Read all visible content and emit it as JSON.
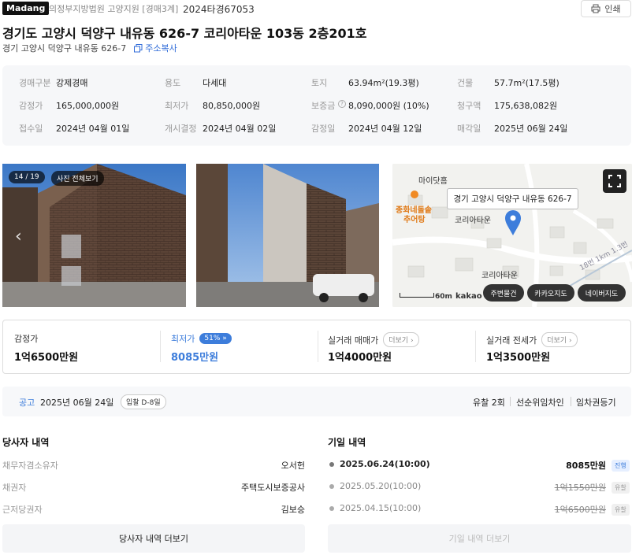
{
  "header": {
    "logo": "Madang",
    "court": "의정부지방법원 고양지원 [경매3계]",
    "case_number": "2024타경67053",
    "print_label": "인쇄"
  },
  "title": "경기도 고양시 덕양구 내유동 626-7 코리아타운 103동 2층201호",
  "address": {
    "text": "경기 고양시 덕양구 내유동 626-7",
    "copy_label": "주소복사"
  },
  "info": {
    "r1": [
      {
        "k": "경매구분",
        "v": "강제경매"
      },
      {
        "k": "용도",
        "v": "다세대"
      },
      {
        "k": "토지",
        "v": "63.94m²(19.3평)"
      },
      {
        "k": "건물",
        "v": "57.7m²(17.5평)"
      }
    ],
    "r2": [
      {
        "k": "감정가",
        "v": "165,000,000원"
      },
      {
        "k": "최저가",
        "v": "80,850,000원"
      },
      {
        "k": "보증금",
        "v": "8,090,000원 (10%)"
      },
      {
        "k": "청구액",
        "v": "175,638,082원"
      }
    ],
    "r3": [
      {
        "k": "접수일",
        "v": "2024년 04월 01일"
      },
      {
        "k": "개시결정",
        "v": "2024년 04월 02일"
      },
      {
        "k": "감정일",
        "v": "2024년 04월 12일"
      },
      {
        "k": "매각일",
        "v": "2025년 06월 24일"
      }
    ]
  },
  "photos": {
    "counter": "14 / 19",
    "view_all": "사진 전체보기"
  },
  "map": {
    "tooltip": "경기 고양시 덕양구 내유동 626-7",
    "labels": {
      "mart": "마이닷홈",
      "restaurant": "종화네돌솥",
      "restaurant2": "추어탕",
      "korea1": "코리아타운",
      "korea2": "코리아타운",
      "road": "18번 1km 1.3번",
      "scale": "60m",
      "kakao": "kakao"
    },
    "buttons": [
      "주변물건",
      "카카오지도",
      "네이버지도"
    ]
  },
  "prices": [
    {
      "label": "감정가",
      "value": "1억6500만원"
    },
    {
      "label": "최저가",
      "value": "8085만원",
      "pill": "51%"
    },
    {
      "label": "실거래 매매가",
      "value": "1억4000만원",
      "more": "더보기"
    },
    {
      "label": "실거래 전세가",
      "value": "1억3500만원",
      "more": "더보기"
    }
  ],
  "notice": {
    "label": "공고",
    "date": "2025년 06월 24일",
    "dday": "입찰 D-8일",
    "fail": "유찰 2회",
    "tag1": "선순위임차인",
    "tag2": "임차권등기"
  },
  "parties": {
    "title": "당사자 내역",
    "rows": [
      {
        "k": "채무자겸소유자",
        "v": "오서헌"
      },
      {
        "k": "채권자",
        "v": "주택도시보증공사"
      },
      {
        "k": "근저당권자",
        "v": "김보승"
      }
    ],
    "more": "당사자 내역 더보기"
  },
  "history": {
    "title": "기일 내역",
    "rows": [
      {
        "date": "2025.06.24(10:00)",
        "price": "8085만원",
        "tag": "진행"
      },
      {
        "date": "2025.05.20(10:00)",
        "price": "1억1550만원",
        "tag": "유찰"
      },
      {
        "date": "2025.04.15(10:00)",
        "price": "1억6500만원",
        "tag": "유찰"
      }
    ],
    "more": "기일 내역 더보기"
  },
  "colors": {
    "accent": "#3d7ddb",
    "copy": "#2f6bd8",
    "pin": "#3d7ddb"
  }
}
